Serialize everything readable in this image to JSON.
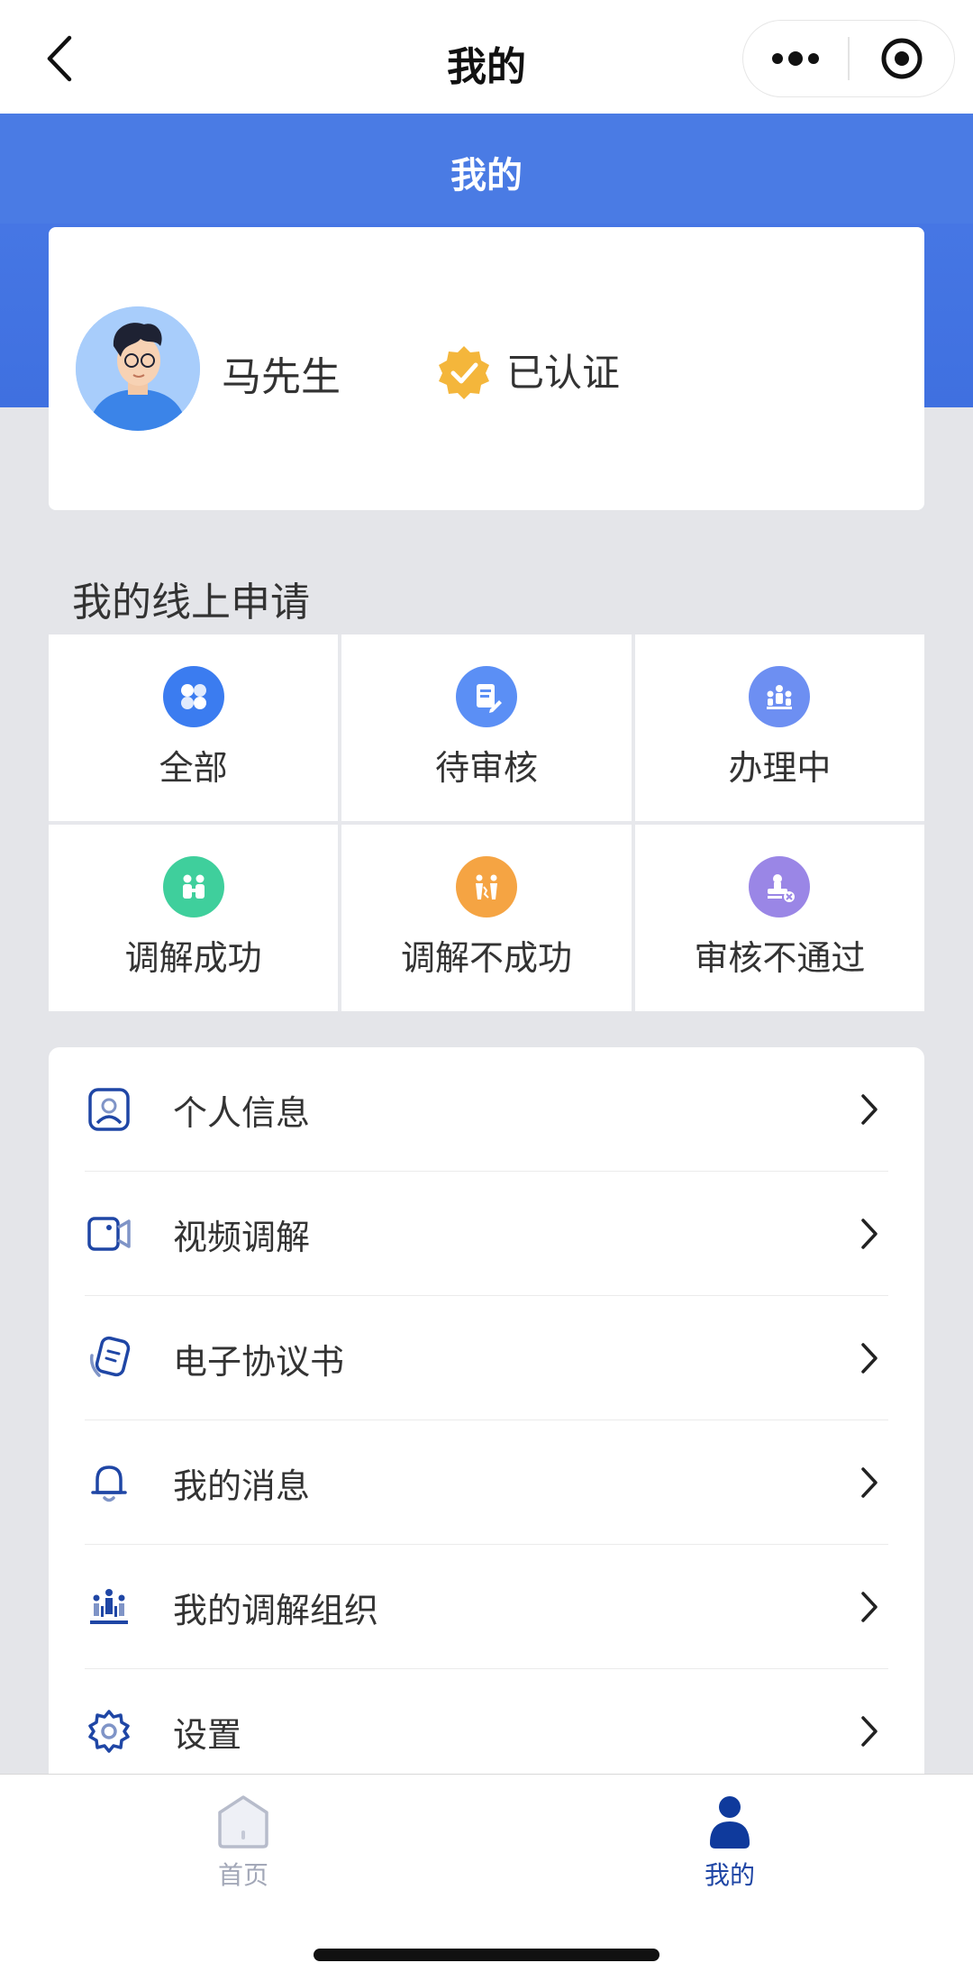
{
  "nav": {
    "title": "我的"
  },
  "header": {
    "title": "我的"
  },
  "profile": {
    "name": "马先生",
    "status": "已认证"
  },
  "applications": {
    "title": "我的线上申请",
    "items": [
      {
        "label": "全部",
        "icon": "grid-icon",
        "color": "#3b7cf0"
      },
      {
        "label": "待审核",
        "icon": "document-icon",
        "color": "#5b8ff5"
      },
      {
        "label": "办理中",
        "icon": "meeting-icon",
        "color": "#6d8ff2"
      },
      {
        "label": "调解成功",
        "icon": "handshake-icon",
        "color": "#3fcf9c"
      },
      {
        "label": "调解不成功",
        "icon": "broken-icon",
        "color": "#f5a443"
      },
      {
        "label": "审核不通过",
        "icon": "rejected-icon",
        "color": "#9a86e6"
      }
    ]
  },
  "menu": {
    "items": [
      {
        "label": "个人信息",
        "icon": "profile-icon"
      },
      {
        "label": "视频调解",
        "icon": "video-icon"
      },
      {
        "label": "电子协议书",
        "icon": "agreement-icon"
      },
      {
        "label": "我的消息",
        "icon": "bell-icon"
      },
      {
        "label": "我的调解组织",
        "icon": "organization-icon"
      },
      {
        "label": "设置",
        "icon": "gear-icon"
      }
    ]
  },
  "tabbar": {
    "home": "首页",
    "mine": "我的"
  },
  "colors": {
    "primary_blue": "#4a7be4",
    "icon_navy": "#1f46a5",
    "tab_inactive": "#a3a8b8"
  }
}
